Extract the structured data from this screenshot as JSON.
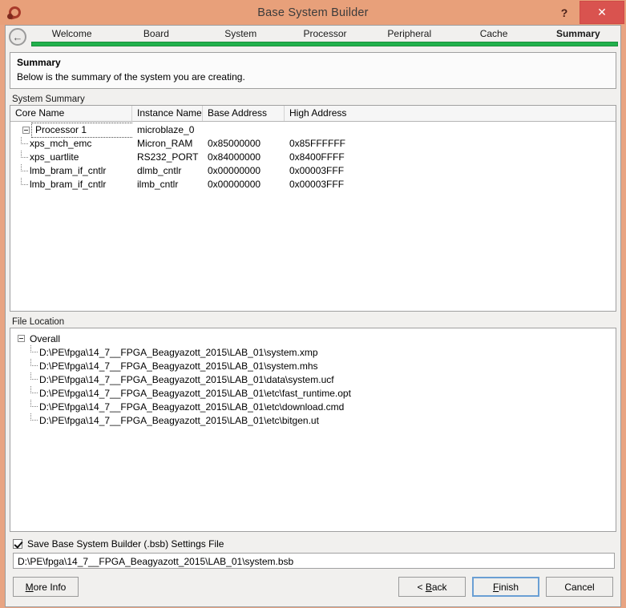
{
  "window": {
    "title": "Base System Builder",
    "app_icon": "app-logo-icon",
    "help_label": "?",
    "close_label": "✕"
  },
  "nav": {
    "back_icon": "←",
    "tabs": [
      {
        "label": "Welcome",
        "active": false
      },
      {
        "label": "Board",
        "active": false
      },
      {
        "label": "System",
        "active": false
      },
      {
        "label": "Processor",
        "active": false
      },
      {
        "label": "Peripheral",
        "active": false
      },
      {
        "label": "Cache",
        "active": false
      },
      {
        "label": "Summary",
        "active": true
      }
    ],
    "progress_color": "#22b14c"
  },
  "header": {
    "title": "Summary",
    "subtitle": "Below is the summary of the system you are creating."
  },
  "system_summary": {
    "group_label": "System Summary",
    "columns": [
      "Core Name",
      "Instance Name",
      "Base Address",
      "High Address"
    ],
    "root": {
      "core_name": "Processor 1",
      "instance_name": "microblaze_0",
      "base_address": "",
      "high_address": ""
    },
    "rows": [
      {
        "core_name": "xps_mch_emc",
        "instance_name": "Micron_RAM",
        "base_address": "0x85000000",
        "high_address": "0x85FFFFFF"
      },
      {
        "core_name": "xps_uartlite",
        "instance_name": "RS232_PORT",
        "base_address": "0x84000000",
        "high_address": "0x8400FFFF"
      },
      {
        "core_name": "lmb_bram_if_cntlr",
        "instance_name": "dlmb_cntlr",
        "base_address": "0x00000000",
        "high_address": "0x00003FFF"
      },
      {
        "core_name": "lmb_bram_if_cntlr",
        "instance_name": "ilmb_cntlr",
        "base_address": "0x00000000",
        "high_address": "0x00003FFF"
      }
    ]
  },
  "file_location": {
    "group_label": "File Location",
    "root_label": "Overall",
    "paths": [
      "D:\\PE\\fpga\\14_7__FPGA_Beagyazott_2015\\LAB_01\\system.xmp",
      "D:\\PE\\fpga\\14_7__FPGA_Beagyazott_2015\\LAB_01\\system.mhs",
      "D:\\PE\\fpga\\14_7__FPGA_Beagyazott_2015\\LAB_01\\data\\system.ucf",
      "D:\\PE\\fpga\\14_7__FPGA_Beagyazott_2015\\LAB_01\\etc\\fast_runtime.opt",
      "D:\\PE\\fpga\\14_7__FPGA_Beagyazott_2015\\LAB_01\\etc\\download.cmd",
      "D:\\PE\\fpga\\14_7__FPGA_Beagyazott_2015\\LAB_01\\etc\\bitgen.ut"
    ]
  },
  "save_settings": {
    "checked": true,
    "label": "Save Base System Builder (.bsb) Settings File",
    "path_value": "D:\\PE\\fpga\\14_7__FPGA_Beagyazott_2015\\LAB_01\\system.bsb"
  },
  "buttons": {
    "more_info": "More Info",
    "back": "< Back",
    "finish": "Finish",
    "cancel": "Cancel"
  }
}
